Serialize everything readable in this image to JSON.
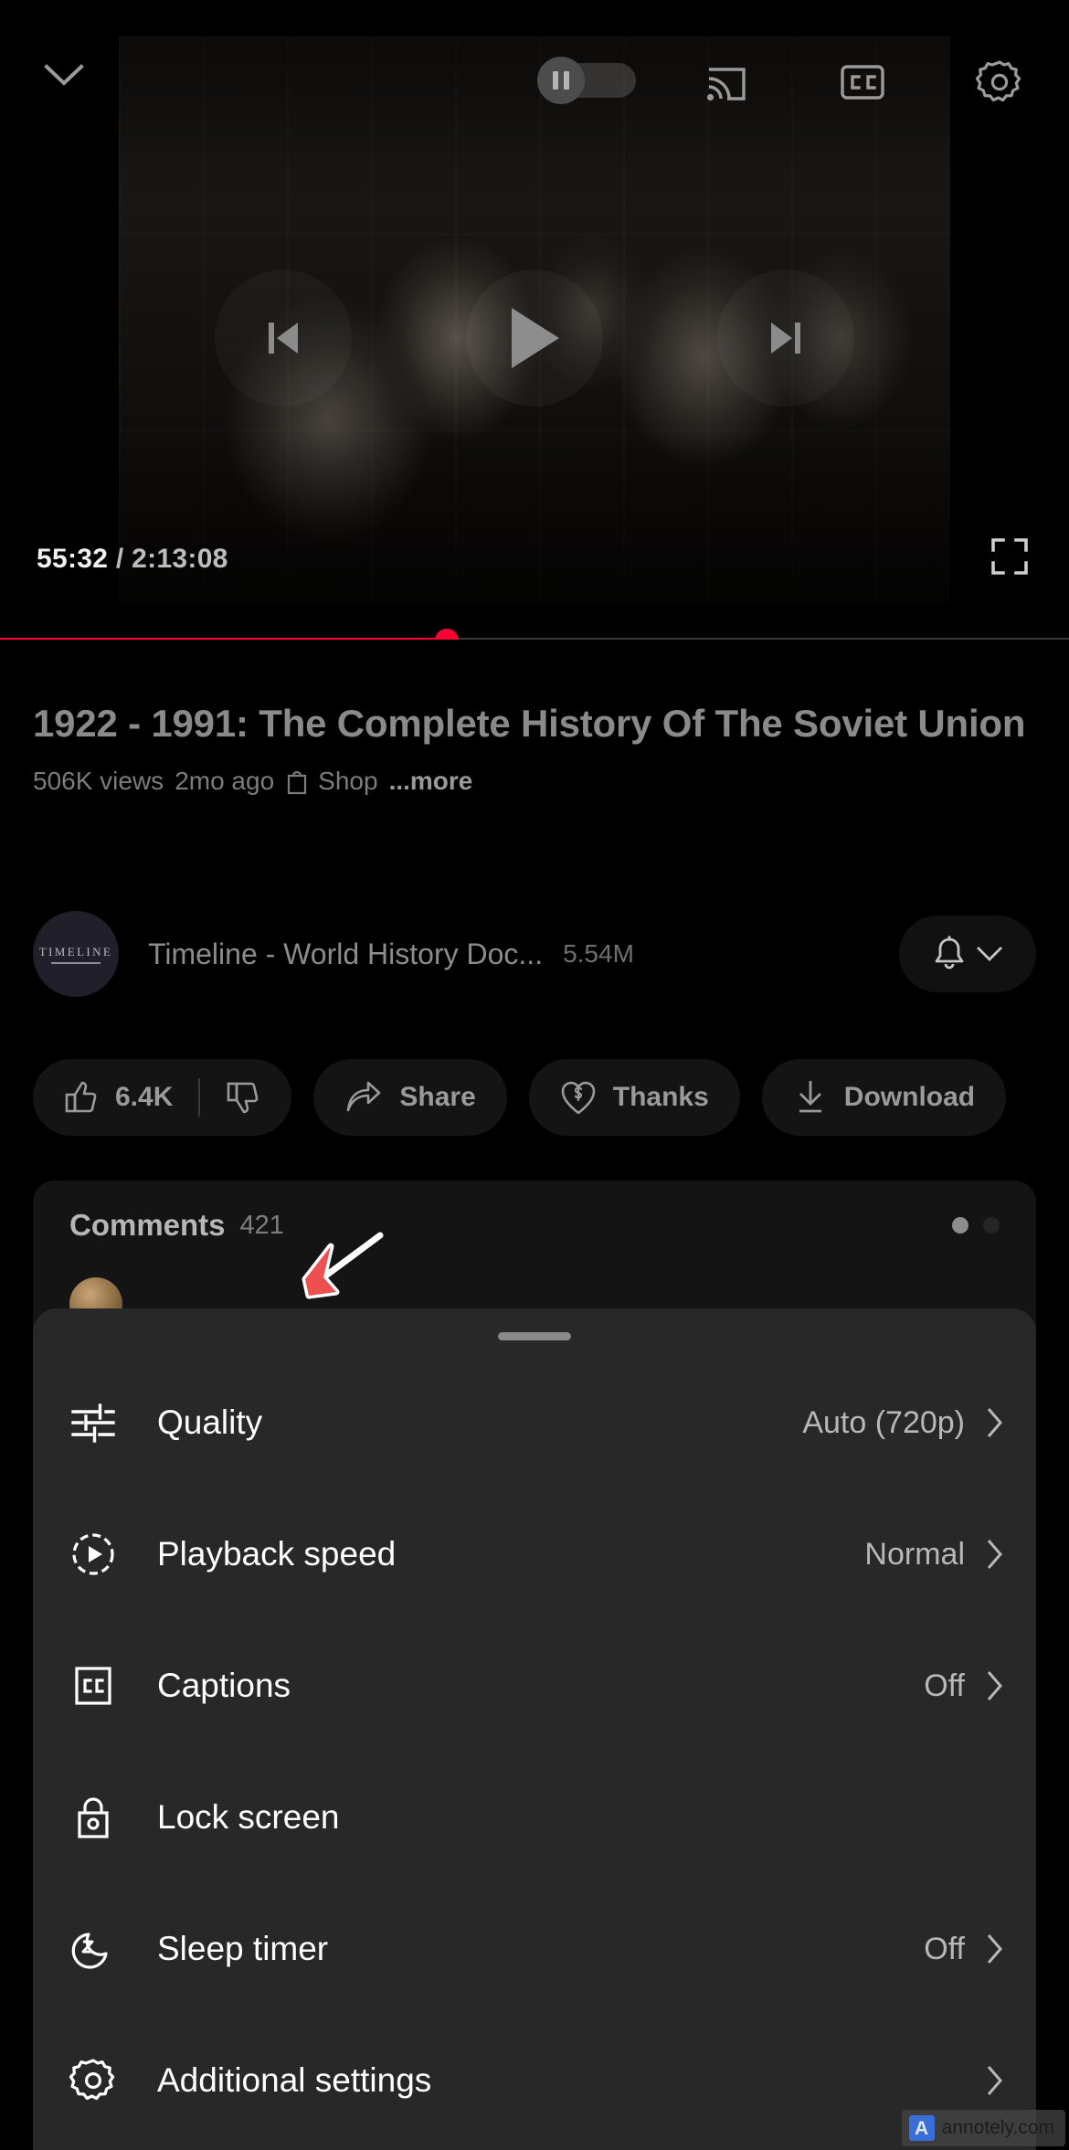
{
  "player": {
    "collapse_icon": "chevron-down-icon",
    "autoplay_icon": "pause-toggle",
    "cast_icon": "cast-icon",
    "captions_icon": "closed-caption-icon",
    "settings_icon": "gear-icon",
    "previous_icon": "skip-previous-icon",
    "play_icon": "play-icon",
    "next_icon": "skip-next-icon",
    "current_time": "55:32",
    "time_separator": "/",
    "total_time": "2:13:08",
    "fullscreen_icon": "fullscreen-icon",
    "progress_percent": 41.8,
    "progress_color": "#ff0033"
  },
  "video": {
    "title": "1922 - 1991: The Complete History Of The Soviet Union",
    "views": "506K views",
    "published": "2mo ago",
    "shop_icon": "shopping-bag-icon",
    "shop_label": "Shop",
    "more_label": "...more"
  },
  "channel": {
    "avatar_text": "TIMELINE",
    "name": "Timeline - World History Doc...",
    "subscribers": "5.54M",
    "bell_icon": "bell-icon",
    "chevron_icon": "chevron-down-icon"
  },
  "actions": [
    {
      "name": "like",
      "icon": "thumbs-up-icon",
      "label": "6.4K",
      "has_divider": true,
      "second_icon": "thumbs-down-icon"
    },
    {
      "name": "share",
      "icon": "share-icon",
      "label": "Share"
    },
    {
      "name": "thanks",
      "icon": "heart-dollar-icon",
      "label": "Thanks"
    },
    {
      "name": "download",
      "icon": "download-icon",
      "label": "Download"
    }
  ],
  "comments": {
    "title": "Comments",
    "count": "421",
    "page_dots": 2,
    "active_dot": 0
  },
  "settings_sheet": {
    "rows": [
      {
        "icon": "tune-sliders-icon",
        "label": "Quality",
        "value": "Auto (720p)",
        "chevron": true
      },
      {
        "icon": "playback-speed-icon",
        "label": "Playback speed",
        "value": "Normal",
        "chevron": true
      },
      {
        "icon": "closed-caption-icon",
        "label": "Captions",
        "value": "Off",
        "chevron": true
      },
      {
        "icon": "lock-icon",
        "label": "Lock screen",
        "value": "",
        "chevron": false
      },
      {
        "icon": "sleep-moon-icon",
        "label": "Sleep timer",
        "value": "Off",
        "chevron": true
      },
      {
        "icon": "gear-icon",
        "label": "Additional settings",
        "value": "",
        "chevron": true
      }
    ]
  },
  "annotation": {
    "arrow_icon": "red-arrow-annotation",
    "arrow_color": "#ee4f4f",
    "arrow_outline": "#ffffff",
    "points_at": "Sleep timer"
  },
  "watermark": {
    "logo_letter": "A",
    "text": "annotely.com",
    "logo_color": "#3a6fd8"
  }
}
